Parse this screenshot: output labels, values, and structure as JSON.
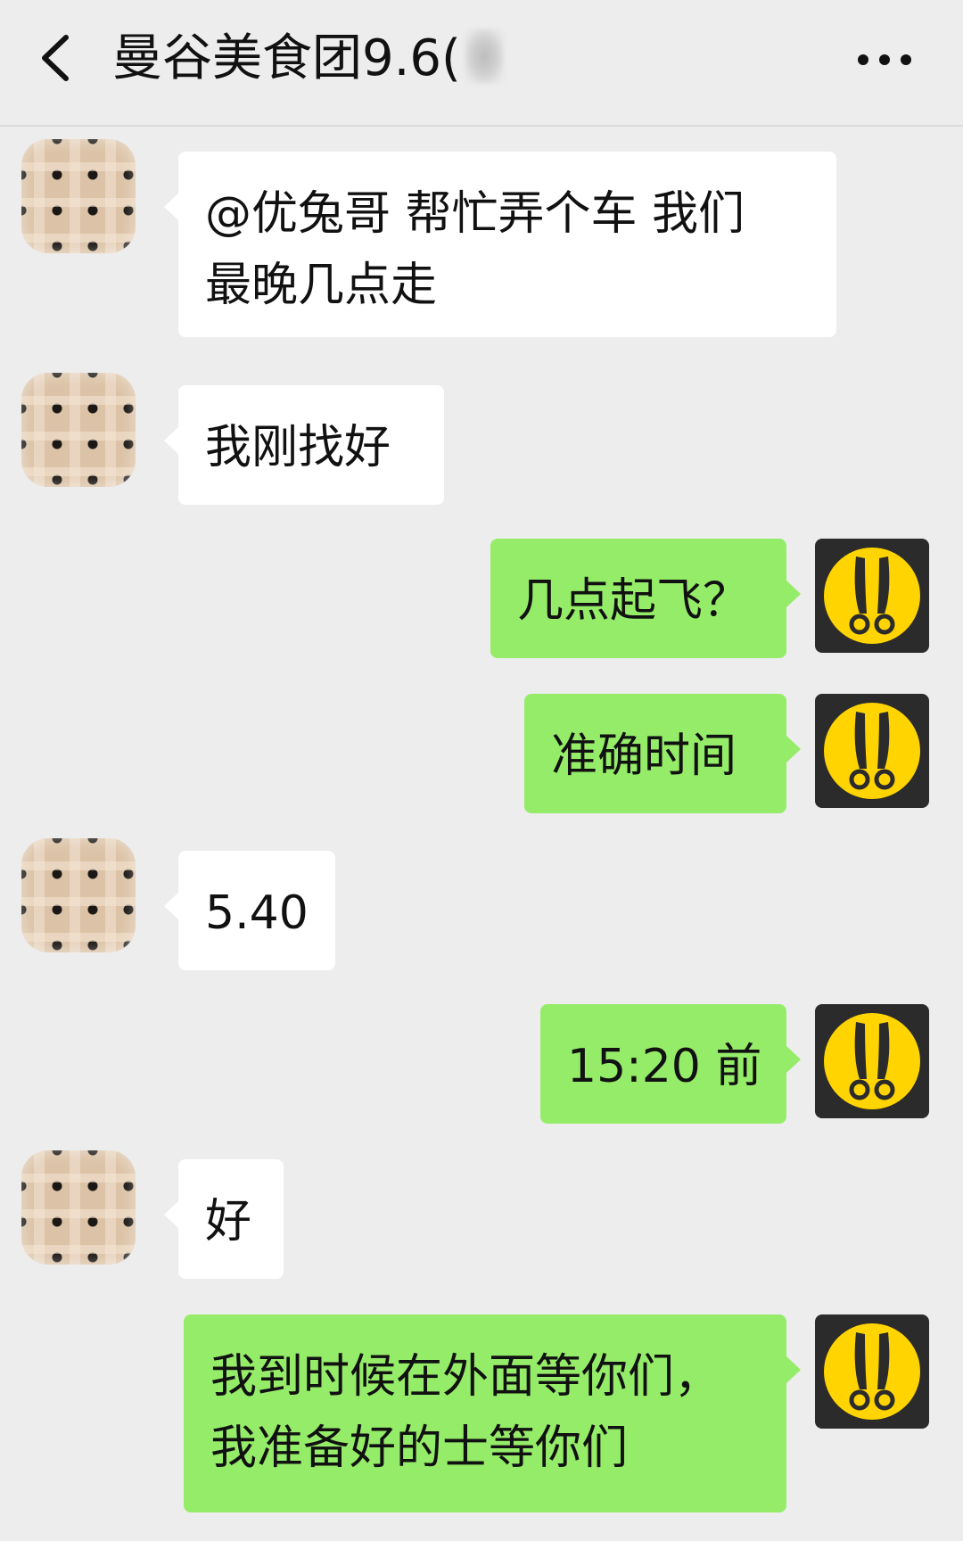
{
  "header": {
    "back_icon": "chevron-left-icon",
    "title": "曼谷美食团9.6(",
    "more_icon": "more-dots-icon"
  },
  "colors": {
    "background": "#ededed",
    "incoming_bubble": "#ffffff",
    "outgoing_bubble": "#95ec69",
    "self_avatar_bg": "#2b2b2b",
    "self_avatar_face": "#ffd400"
  },
  "messages": [
    {
      "side": "left",
      "lines": [
        "@优兔哥  帮忙弄个车 我们",
        "最晚几点走"
      ]
    },
    {
      "side": "left",
      "lines": [
        "我刚找好"
      ]
    },
    {
      "side": "right",
      "lines": [
        "几点起飞？"
      ]
    },
    {
      "side": "right",
      "lines": [
        "准确时间"
      ]
    },
    {
      "side": "left",
      "lines": [
        "5.40"
      ]
    },
    {
      "side": "right",
      "lines": [
        "15:20 前"
      ]
    },
    {
      "side": "left",
      "lines": [
        "好"
      ]
    },
    {
      "side": "right",
      "lines": [
        "我到时候在外面等你们，",
        "我准备好的士等你们"
      ]
    }
  ]
}
